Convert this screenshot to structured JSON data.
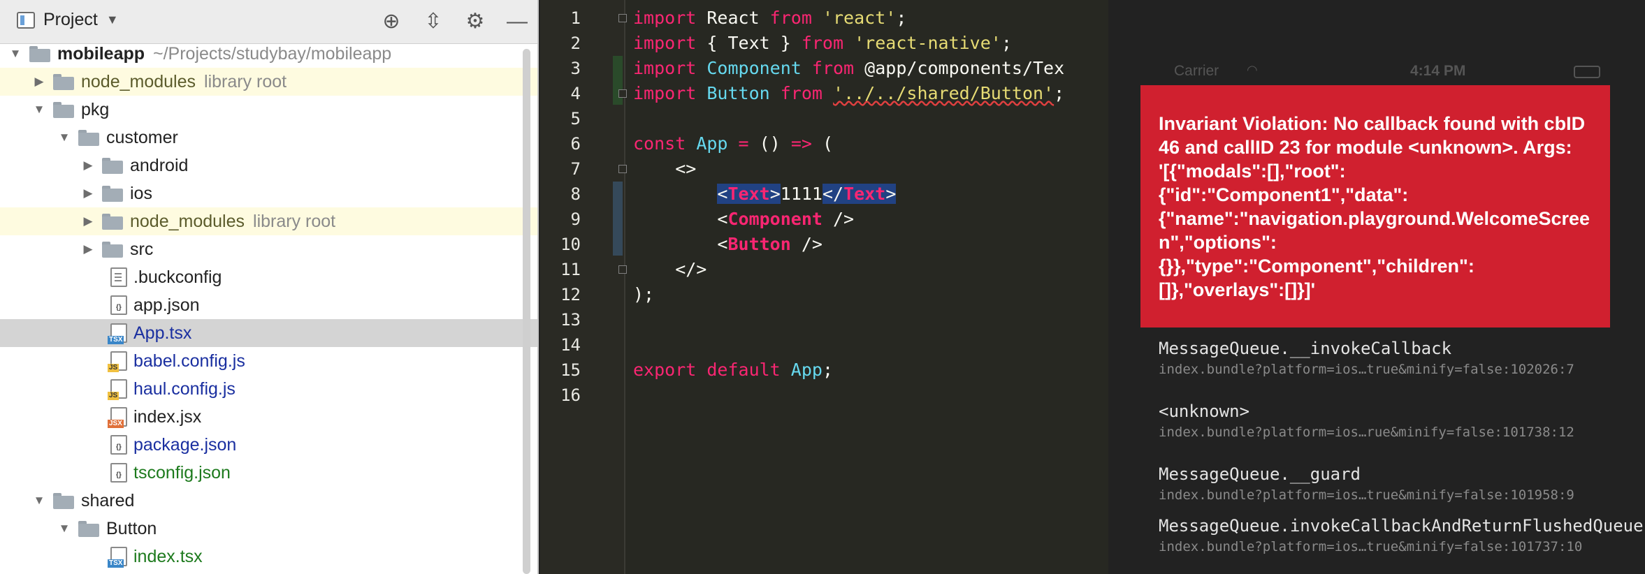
{
  "project_panel": {
    "title": "Project",
    "tools": {
      "locate_icon": "crosshair-icon",
      "collapse_icon": "collapse-all-icon",
      "settings_icon": "gear-icon",
      "hide_icon": "minimize-icon"
    },
    "tree": [
      {
        "name": "mobileapp",
        "path": "~/Projects/studybay/mobileapp",
        "kind": "folder",
        "expanded": true,
        "depth": 0
      },
      {
        "name": "node_modules",
        "path": "library root",
        "kind": "folder",
        "expanded": false,
        "depth": 1,
        "library": true
      },
      {
        "name": "pkg",
        "kind": "folder",
        "expanded": true,
        "depth": 1
      },
      {
        "name": "customer",
        "kind": "folder",
        "expanded": true,
        "depth": 2
      },
      {
        "name": "android",
        "kind": "folder",
        "expanded": false,
        "depth": 3
      },
      {
        "name": "ios",
        "kind": "folder",
        "expanded": false,
        "depth": 3
      },
      {
        "name": "node_modules",
        "path": "library root",
        "kind": "folder",
        "expanded": false,
        "depth": 3,
        "library": true
      },
      {
        "name": "src",
        "kind": "folder",
        "expanded": false,
        "depth": 3
      },
      {
        "name": ".buckconfig",
        "kind": "file",
        "depth": 3
      },
      {
        "name": "app.json",
        "kind": "file",
        "depth": 3
      },
      {
        "name": "App.tsx",
        "kind": "file",
        "depth": 3,
        "selected": true
      },
      {
        "name": "babel.config.js",
        "kind": "file",
        "depth": 3
      },
      {
        "name": "haul.config.js",
        "kind": "file",
        "depth": 3
      },
      {
        "name": "index.jsx",
        "kind": "file",
        "depth": 3
      },
      {
        "name": "package.json",
        "kind": "file",
        "depth": 3
      },
      {
        "name": "tsconfig.json",
        "kind": "file",
        "depth": 3
      },
      {
        "name": "shared",
        "kind": "folder",
        "expanded": true,
        "depth": 1
      },
      {
        "name": "Button",
        "kind": "folder",
        "expanded": true,
        "depth": 2
      },
      {
        "name": "index.tsx",
        "kind": "file",
        "depth": 3
      }
    ]
  },
  "editor": {
    "line_numbers": [
      "1",
      "2",
      "3",
      "4",
      "5",
      "6",
      "7",
      "8",
      "9",
      "10",
      "11",
      "12",
      "13",
      "14",
      "15",
      "16"
    ],
    "lines": [
      "import React from 'react';",
      "import { Text } from 'react-native';",
      "import Component from '@app/components/Tex",
      "import Button from '../../shared/Button';",
      "",
      "const App = () => (",
      "    <>",
      "        <Text>1111</Text>",
      "        <Component />",
      "        <Button />",
      "    </>",
      ");",
      "",
      "",
      "export default App;",
      ""
    ]
  },
  "simulator": {
    "status_bar": {
      "carrier": "Carrier",
      "time": "4:14 PM"
    },
    "error_message": "Invariant Violation: No callback found with cbID 46 and callID 23 for module <unknown>. Args: '[{\"modals\":[],\"root\":{\"id\":\"Component1\",\"data\":{\"name\":\"navigation.playground.WelcomeScreen\",\"options\":{}},\"type\":\"Component\",\"children\":[]},\"overlays\":[]}]'",
    "stack": [
      {
        "fn": "MessageQueue.__invokeCallback",
        "loc": "index.bundle?platform=ios…true&minify=false:102026:7"
      },
      {
        "fn": "<unknown>",
        "loc": "index.bundle?platform=ios…rue&minify=false:101738:12"
      },
      {
        "fn": "MessageQueue.__guard",
        "loc": "index.bundle?platform=ios…true&minify=false:101958:9"
      },
      {
        "fn": "MessageQueue.invokeCallbackAndReturnFlushedQueue",
        "loc": "index.bundle?platform=ios…true&minify=false:101737:10"
      }
    ]
  },
  "colors": {
    "error_red": "#d0202f",
    "keyword": "#f92672",
    "string": "#e6db74",
    "type": "#66d9ef"
  }
}
